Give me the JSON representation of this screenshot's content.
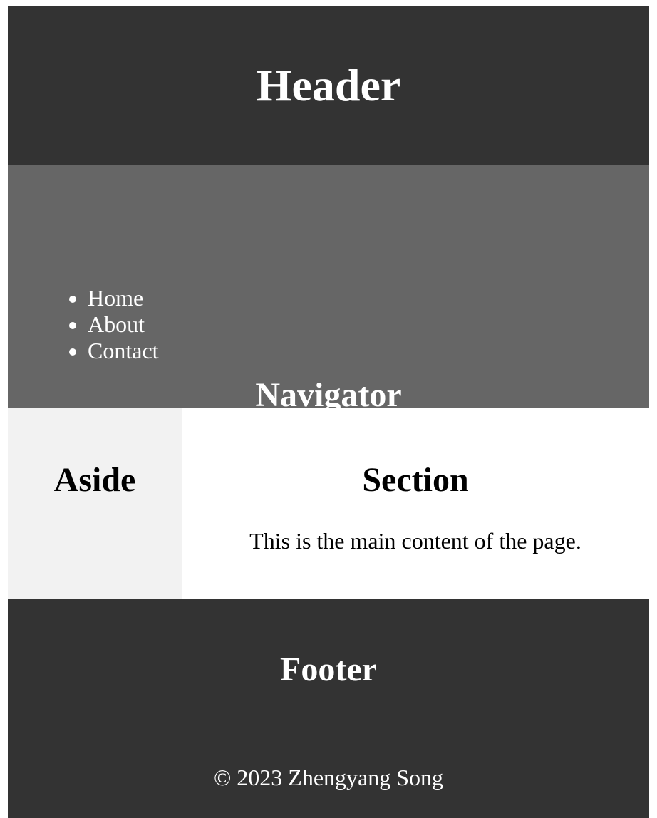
{
  "header": {
    "title": "Header"
  },
  "nav": {
    "title": "Navigator",
    "items": [
      {
        "label": "Home"
      },
      {
        "label": "About"
      },
      {
        "label": "Contact"
      }
    ]
  },
  "aside": {
    "title": "Aside"
  },
  "section": {
    "title": "Section",
    "text": "This is the main content of the page."
  },
  "footer": {
    "title": "Footer",
    "copyright": "© 2023 Zhengyang Song"
  },
  "colors": {
    "header_bg": "#333333",
    "nav_bg": "#666666",
    "aside_bg": "#f2f2f2",
    "section_bg": "#ffffff",
    "footer_bg": "#333333"
  }
}
